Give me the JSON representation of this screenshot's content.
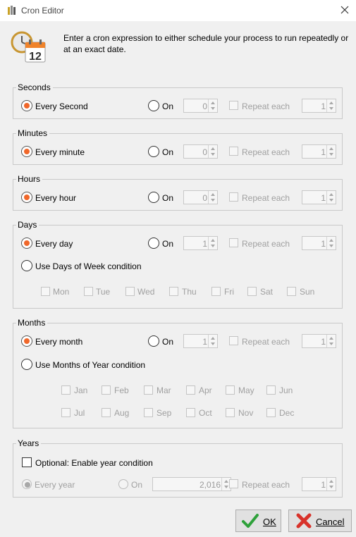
{
  "window": {
    "title": "Cron Editor"
  },
  "header": {
    "description": "Enter a cron expression to either schedule your process to run repeatedly or at an exact date.",
    "calendar_day": "12"
  },
  "seconds": {
    "legend": "Seconds",
    "every_label": "Every Second",
    "on_label": "On",
    "on_value": "0",
    "repeat_label": "Repeat each",
    "repeat_value": "1"
  },
  "minutes": {
    "legend": "Minutes",
    "every_label": "Every minute",
    "on_label": "On",
    "on_value": "0",
    "repeat_label": "Repeat each",
    "repeat_value": "1"
  },
  "hours": {
    "legend": "Hours",
    "every_label": "Every hour",
    "on_label": "On",
    "on_value": "0",
    "repeat_label": "Repeat each",
    "repeat_value": "1"
  },
  "days": {
    "legend": "Days",
    "every_label": "Every day",
    "on_label": "On",
    "on_value": "1",
    "repeat_label": "Repeat each",
    "repeat_value": "1",
    "weekday_label": "Use Days of Week condition",
    "weekdays": [
      "Mon",
      "Tue",
      "Wed",
      "Thu",
      "Fri",
      "Sat",
      "Sun"
    ]
  },
  "months": {
    "legend": "Months",
    "every_label": "Every month",
    "on_label": "On",
    "on_value": "1",
    "repeat_label": "Repeat each",
    "repeat_value": "1",
    "year_cond_label": "Use Months of Year condition",
    "row1": [
      "Jan",
      "Feb",
      "Mar",
      "Apr",
      "May",
      "Jun"
    ],
    "row2": [
      "Jul",
      "Aug",
      "Sep",
      "Oct",
      "Nov",
      "Dec"
    ]
  },
  "years": {
    "legend": "Years",
    "optional_label": "Optional: Enable year condition",
    "every_label": "Every year",
    "on_label": "On",
    "on_value": "2,016",
    "repeat_label": "Repeat each",
    "repeat_value": "1"
  },
  "buttons": {
    "ok": "OK",
    "cancel": "Cancel"
  },
  "colors": {
    "accent_radio": "#f0672a",
    "ok_check": "#2ea13a",
    "cancel_x": "#d8322a"
  }
}
